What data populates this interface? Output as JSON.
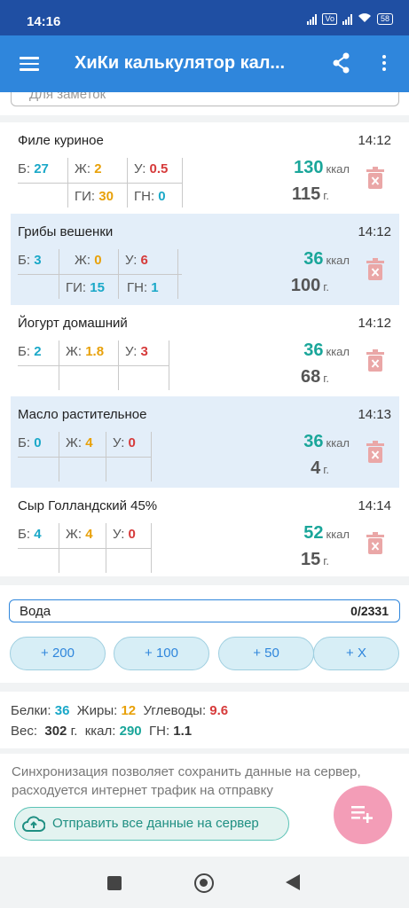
{
  "status_bar": {
    "time": "14:16",
    "network": "Vo",
    "battery": "58"
  },
  "app_bar": {
    "title": "ХиКи калькулятор кал..."
  },
  "notes": {
    "placeholder": "Для заметок"
  },
  "food_items": [
    {
      "name": "Филе куриное",
      "time": "14:12",
      "b": "27",
      "zh": "2",
      "u": "0.5",
      "gi": "30",
      "gn": "0",
      "kcal": "130",
      "weight": "115"
    },
    {
      "name": "Грибы вешенки",
      "time": "14:12",
      "b": "3",
      "zh": "0",
      "u": "6",
      "gi": "15",
      "gn": "1",
      "kcal": "36",
      "weight": "100"
    },
    {
      "name": "Йогурт домашний",
      "time": "14:12",
      "b": "2",
      "zh": "1.8",
      "u": "3",
      "gi": "",
      "gn": "",
      "kcal": "36",
      "weight": "68"
    },
    {
      "name": "Масло растительное",
      "time": "14:13",
      "b": "0",
      "zh": "4",
      "u": "0",
      "gi": "",
      "gn": "",
      "kcal": "36",
      "weight": "4"
    },
    {
      "name": "Сыр Голландский 45%",
      "time": "14:14",
      "b": "4",
      "zh": "4",
      "u": "0",
      "gi": "",
      "gn": "",
      "kcal": "52",
      "weight": "15"
    }
  ],
  "labels": {
    "b": "Б:",
    "zh": "Ж:",
    "u": "У:",
    "gi": "ГИ:",
    "gn": "ГН:",
    "kcal_unit": "ккал",
    "weight_unit": "г."
  },
  "water": {
    "label": "Вода",
    "value": "0/2331",
    "buttons": [
      "+ 200",
      "+ 100",
      "+ 50",
      "+ X"
    ]
  },
  "summary": {
    "proteins_label": "Белки:",
    "proteins": "36",
    "fats_label": "Жиры:",
    "fats": "12",
    "carbs_label": "Углеводы:",
    "carbs": "9.6",
    "weight_label": "Вес:",
    "weight": "302",
    "weight_unit": "г.",
    "kcal_label": "ккал:",
    "kcal": "290",
    "gn_label": "ГН:",
    "gn": "1.1"
  },
  "sync": {
    "text": "Синхронизация позволяет сохранить данные на сервер, расходуется интернет трафик на отправку",
    "button_label": "Отправить все данные на сервер"
  },
  "colors": {
    "appbar": "#2f86dc",
    "statusbar": "#1f4fa3",
    "protein": "#1aa8c8",
    "fat": "#e8a10a",
    "carbs": "#d63a3a",
    "kcal": "#1aa69a",
    "fab": "#f18dab"
  }
}
